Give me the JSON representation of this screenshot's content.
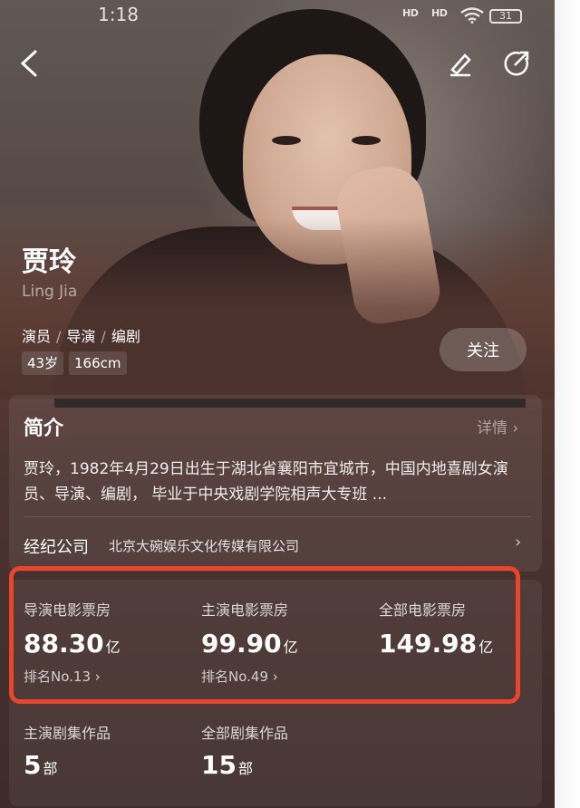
{
  "status_bar": {
    "time": "1:18",
    "signal_1": "HD",
    "signal_2": "HD",
    "battery": "31"
  },
  "profile": {
    "name": "贾玲",
    "latin_name": "Ling Jia",
    "roles": [
      "演员",
      "导演",
      "编剧"
    ],
    "age": "43岁",
    "height": "166cm",
    "follow_label": "关注"
  },
  "intro": {
    "title": "简介",
    "detail_label": "详情",
    "text": "贾玲，1982年4月29日出生于湖北省襄阳市宜城市，中国内地喜剧女演员、导演、编剧， 毕业于中央戏剧学院相声大专班 ..."
  },
  "agency": {
    "label": "经纪公司",
    "value": "北京大碗娱乐文化传媒有限公司"
  },
  "box_office": {
    "directed": {
      "label": "导演电影票房",
      "value": "88.30",
      "unit": "亿",
      "rank": "排名No.13"
    },
    "starred": {
      "label": "主演电影票房",
      "value": "99.90",
      "unit": "亿",
      "rank": "排名No.49"
    },
    "total": {
      "label": "全部电影票房",
      "value": "149.98",
      "unit": "亿"
    }
  },
  "series": {
    "starred": {
      "label": "主演剧集作品",
      "value": "5",
      "unit": "部"
    },
    "total": {
      "label": "全部剧集作品",
      "value": "15",
      "unit": "部"
    }
  },
  "colors": {
    "highlight": "#e8442e",
    "background": "#4b3330"
  }
}
